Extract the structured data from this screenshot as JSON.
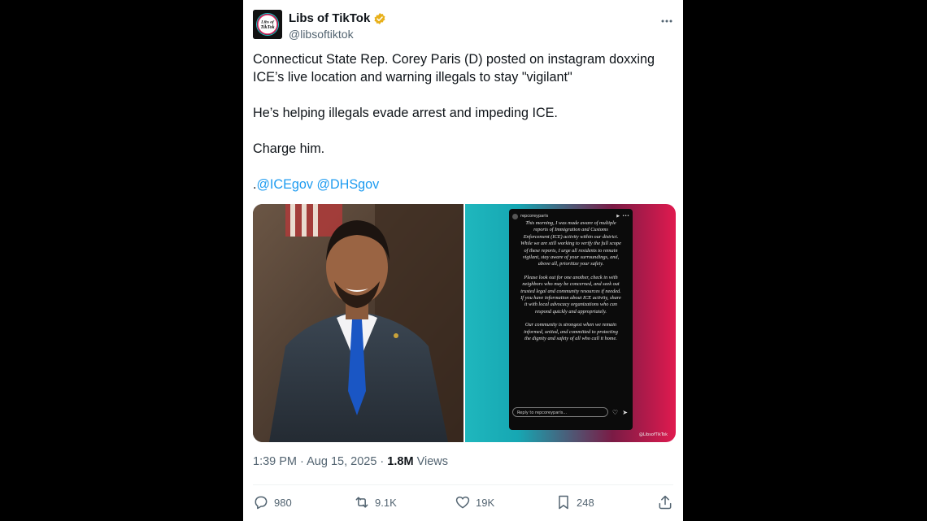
{
  "author": {
    "display_name": "Libs of TikTok",
    "handle": "@libsoftiktok",
    "avatar_text_1": "Libs of",
    "avatar_text_2": "TikTok",
    "verified_color": "#e8b01a"
  },
  "tweet": {
    "line1": "Connecticut State Rep. Corey Paris (D) posted on instagram doxxing ICE’s live location and warning illegals to stay \"vigilant\"",
    "line2": "He’s helping illegals evade arrest and impeding ICE.",
    "line3": "Charge him.",
    "mention_prefix": ".",
    "mention_1": "@ICEgov",
    "mention_2": "@DHSgov"
  },
  "story": {
    "username": "repcoreyparis",
    "paragraph_1": "This morning, I was made aware of multiple reports of Immigration and Customs Enforcement (ICE) activity within our district. While we are still working to verify the full scope of these reports, I urge all residents to remain vigilant, stay aware of your surroundings, and, above all, prioritize your safety.",
    "paragraph_2": "Please look out for one another, check in with neighbors who may be concerned, and seek out trusted legal and community resources if needed. If you have information about ICE activity, share it with local advocacy organizations who can respond quickly and appropriately.",
    "paragraph_3": "Our community is strongest when we remain informed, united, and committed to protecting the dignity and safety of all who call it home.",
    "reply_placeholder": "Reply to repcoreyparis...",
    "watermark": "@LibsofTikTok"
  },
  "meta": {
    "time": "1:39 PM",
    "separator": "·",
    "date": "Aug 15, 2025",
    "views_count": "1.8M",
    "views_label": "Views"
  },
  "actions": {
    "replies": "980",
    "reposts": "9.1K",
    "likes": "19K",
    "bookmarks": "248"
  },
  "colors": {
    "link": "#1d9bf0",
    "text": "#0f1419",
    "muted": "#536471"
  }
}
